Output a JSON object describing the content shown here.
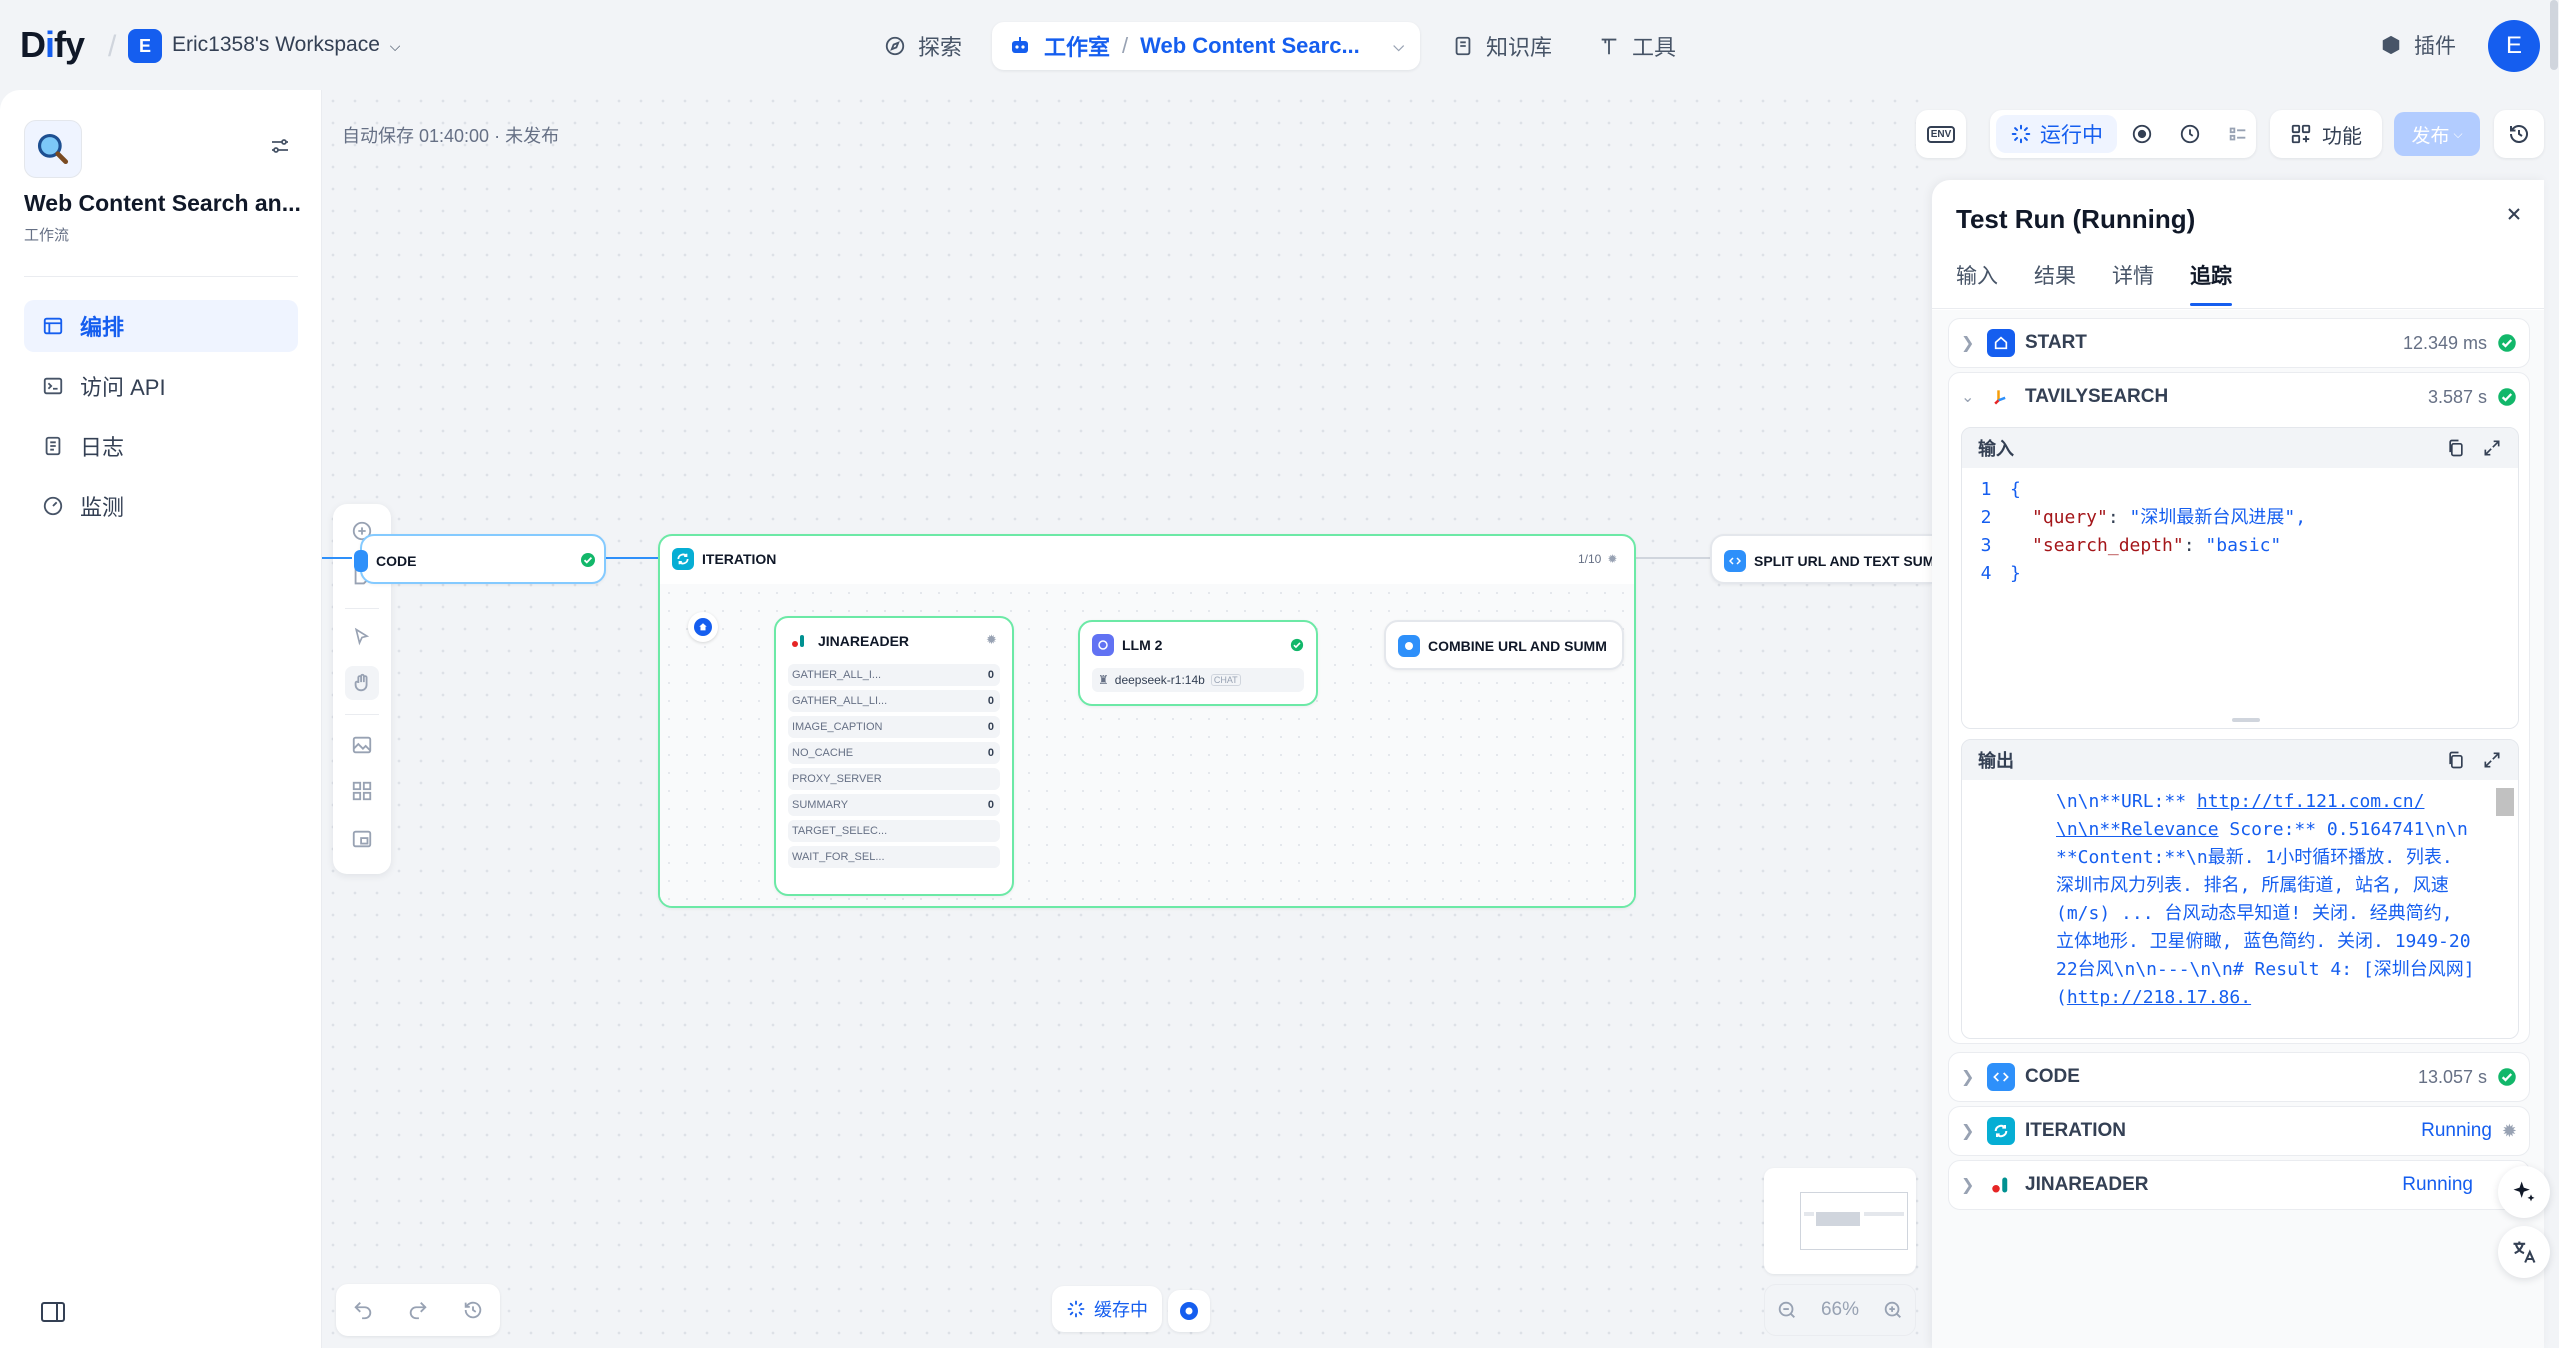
{
  "topbar": {
    "logo": "Dify",
    "workspace_badge": "E",
    "workspace_name": "Eric1358's Workspace",
    "nav_explore": "探索",
    "nav_studio": "工作室",
    "current_app": "Web Content Searc...",
    "nav_knowledge": "知识库",
    "nav_tools": "工具",
    "plugins": "插件",
    "avatar": "E"
  },
  "sidebar": {
    "app_title": "Web Content Search an...",
    "app_type": "工作流",
    "items": [
      {
        "label": "编排",
        "active": true
      },
      {
        "label": "访问 API"
      },
      {
        "label": "日志"
      },
      {
        "label": "监测"
      }
    ]
  },
  "canvas": {
    "autosave": "自动保存 01:40:00 · 未发布",
    "env_label": "ENV",
    "running_label": "运行中",
    "features_label": "功能",
    "publish_label": "发布",
    "cache_label": "缓存中",
    "zoom": "66%",
    "nodes": {
      "code": "CODE",
      "iteration": "ITERATION",
      "iteration_progress": "1/10",
      "split": "SPLIT URL AND TEXT SUM",
      "jinareader": "JINAREADER",
      "llm2": "LLM 2",
      "llm_model": "deepseek-r1:14b",
      "llm_mode": "CHAT",
      "combine": "COMBINE URL AND SUMM",
      "jina_vars": [
        {
          "name": "GATHER_ALL_I...",
          "value": "0"
        },
        {
          "name": "GATHER_ALL_LI...",
          "value": "0"
        },
        {
          "name": "IMAGE_CAPTION",
          "value": "0"
        },
        {
          "name": "NO_CACHE",
          "value": "0"
        },
        {
          "name": "PROXY_SERVER",
          "value": ""
        },
        {
          "name": "SUMMARY",
          "value": "0"
        },
        {
          "name": "TARGET_SELEC...",
          "value": ""
        },
        {
          "name": "WAIT_FOR_SEL...",
          "value": ""
        }
      ]
    }
  },
  "panel": {
    "title": "Test Run (Running)",
    "tabs": [
      "输入",
      "结果",
      "详情",
      "追踪"
    ],
    "traces": {
      "start": {
        "name": "START",
        "time": "12.349 ms"
      },
      "tavily": {
        "name": "TAVILYSEARCH",
        "time": "3.587 s"
      },
      "code": {
        "name": "CODE",
        "time": "13.057 s"
      },
      "iteration": {
        "name": "ITERATION",
        "status": "Running"
      },
      "jinareader": {
        "name": "JINAREADER",
        "status": "Running"
      }
    },
    "input_label": "输入",
    "output_label": "输出",
    "input_code": {
      "l1": "{",
      "l2_key": "\"query\"",
      "l2_val": "\"深圳最新台风进展\",",
      "l3_key": "\"search_depth\"",
      "l3_val": "\"basic\"",
      "l4": "}"
    },
    "output_lines": [
      "\\n\\n**URL:** ",
      "http://tf.121.com.cn/",
      "\\n\\n**Relevance",
      " Score:** 0.5164741\\n\\n**Content:**\\n最新. 1小时循环播放. 列表. 深圳市风力列表. 排名, 所属街道, 站名, 风速(m/s) ... 台风动态早知道! 关闭. 经典简约, 立体地形. 卫星俯瞰, 蓝色简约. 关闭. 1949-2022台风\\n\\n---\\n\\n# Result 4: [深圳台风网](",
      "http://218.17.86."
    ]
  }
}
